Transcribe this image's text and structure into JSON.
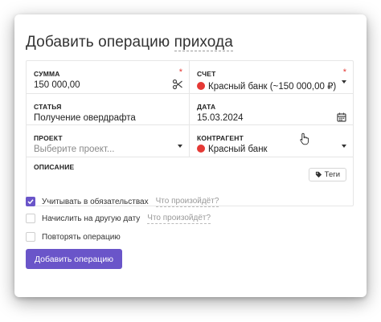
{
  "form": {
    "title_prefix": "Добавить операцию",
    "title_type": "прихода",
    "fields": {
      "amount": {
        "label": "СУММА",
        "value": "150 000,00",
        "required_mark": "*"
      },
      "account": {
        "label": "СЧЕТ",
        "value": "Красный банк (~150 000,00 ₽)",
        "required_mark": "*"
      },
      "article": {
        "label": "СТАТЬЯ",
        "value": "Получение овердрафта"
      },
      "date": {
        "label": "ДАТА",
        "value": "15.03.2024"
      },
      "project": {
        "label": "ПРОЕКТ",
        "placeholder": "Выберите проект..."
      },
      "counterparty": {
        "label": "КОНТРАГЕНТ",
        "value": "Красный банк"
      },
      "description": {
        "label": "ОПИСАНИЕ",
        "tags_label": "Теги"
      }
    },
    "options": [
      {
        "label": "Учитывать в обязательствах",
        "hint": "Что произойдёт?",
        "checked": true
      },
      {
        "label": "Начислить на другую дату",
        "hint": "Что произойдёт?",
        "checked": false
      },
      {
        "label": "Повторять операцию",
        "checked": false
      }
    ],
    "submit_label": "Добавить операцию"
  },
  "colors": {
    "accent": "#6a55c9",
    "bank_dot": "#e53935"
  }
}
